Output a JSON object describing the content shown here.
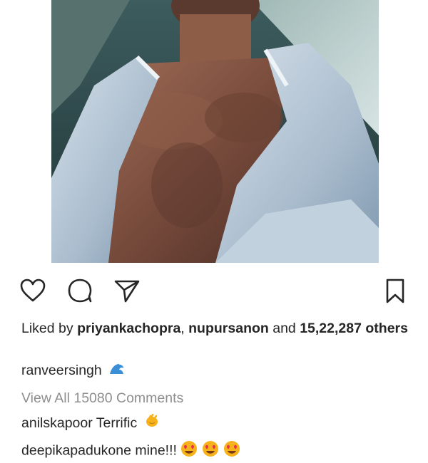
{
  "post": {
    "image_alt": "selfie of a man in an open light shirt by the sea",
    "likes": {
      "prefix": "Liked by ",
      "user1": "priyankachopra",
      "sep": ", ",
      "user2": "nupursanon",
      "and": " and ",
      "count": "15,22,287",
      "others": "others"
    },
    "caption": {
      "username": "ranveersingh",
      "emoji": "wave-emoji"
    },
    "view_all_comments": "View All 15080 Comments",
    "comments": [
      {
        "username": "anilskapoor",
        "text": " Terrific",
        "emoji": "clap-emoji"
      },
      {
        "username": "deepikapadukone",
        "text": " mine!!!",
        "emoji": "heart-eyes-emoji"
      }
    ]
  },
  "icons": {
    "like": "heart-outline-icon",
    "comment": "comment-bubble-icon",
    "share": "paper-plane-icon",
    "save": "bookmark-icon"
  },
  "colors": {
    "text": "#262626",
    "secondary": "#8e8e8e",
    "emoji_yellow": "#f6b21b",
    "wave_blue": "#3b8fd6"
  }
}
